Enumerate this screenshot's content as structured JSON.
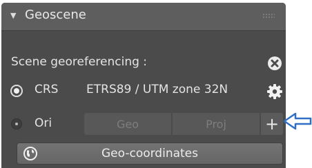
{
  "panel": {
    "title": "Geoscene",
    "icons": {
      "collapse": "triangle-down-icon",
      "drag": "drag-grip-icon"
    }
  },
  "georef": {
    "label": "Scene georeferencing :",
    "reset_icon": "close-circle-icon"
  },
  "crs": {
    "label": "CRS",
    "value": "ETRS89 / UTM zone 32N",
    "settings_icon": "gear-icon",
    "selected": true
  },
  "ori": {
    "label": "Ori",
    "geo_label": "Geo",
    "proj_label": "Proj",
    "add_label": "+",
    "selected": false
  },
  "geo_coordinates": {
    "label": "Geo-coordinates",
    "icon": "globe-icon"
  },
  "annotation": {
    "arrow_icon": "arrow-left-icon",
    "color": "#2f6fc6"
  }
}
